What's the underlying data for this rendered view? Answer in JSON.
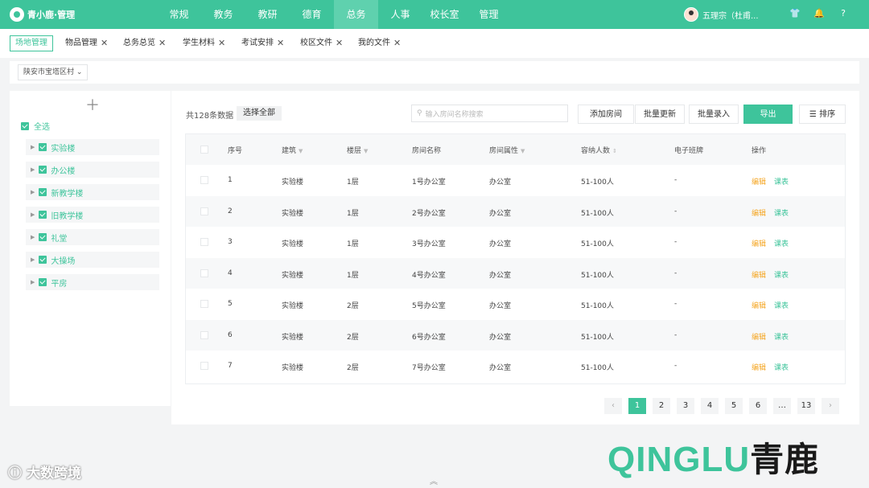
{
  "app": {
    "logo_text": "青小鹿·管理"
  },
  "nav": [
    {
      "label": "常规"
    },
    {
      "label": "教务"
    },
    {
      "label": "教研"
    },
    {
      "label": "德育"
    },
    {
      "label": "总务"
    },
    {
      "label": "人事"
    },
    {
      "label": "校长室"
    },
    {
      "label": "管理"
    }
  ],
  "nav_active": "总务",
  "user": {
    "name": "五理宗（杜甫..."
  },
  "tabs": [
    {
      "label": "场地管理",
      "closable": false,
      "active": true
    },
    {
      "label": "物品管理",
      "closable": true
    },
    {
      "label": "总务总览",
      "closable": true
    },
    {
      "label": "学生材料",
      "closable": true
    },
    {
      "label": "考试安排",
      "closable": true
    },
    {
      "label": "校区文件",
      "closable": true
    },
    {
      "label": "我的文件",
      "closable": true
    }
  ],
  "filter": {
    "region": "陕安市宝塔区村"
  },
  "tree": {
    "all_label": "全选",
    "items": [
      {
        "label": "实验楼"
      },
      {
        "label": "办公楼"
      },
      {
        "label": "新教学楼"
      },
      {
        "label": "旧教学楼"
      },
      {
        "label": "礼堂"
      },
      {
        "label": "大操场"
      },
      {
        "label": "平房"
      }
    ]
  },
  "toolbar": {
    "count_text": "共128条数据",
    "select_all": "选择全部",
    "search_placeholder": "输入房间名称搜索",
    "add_room": "添加房间",
    "batch_update": "批量更新",
    "batch_entry": "批量录入",
    "export": "导出",
    "sort": "排序"
  },
  "table": {
    "headers": {
      "index": "序号",
      "building": "建筑",
      "floor": "楼层",
      "room_name": "房间名称",
      "room_attr": "房间属性",
      "capacity": "容纳人数",
      "eboard": "电子班牌",
      "ops": "操作"
    },
    "rows": [
      {
        "index": "1",
        "building": "实验楼",
        "floor": "1层",
        "room": "1号办公室",
        "attr": "办公室",
        "capacity": "51-100人",
        "eboard": "-",
        "edit": "编辑",
        "sched": "课表"
      },
      {
        "index": "2",
        "building": "实验楼",
        "floor": "1层",
        "room": "2号办公室",
        "attr": "办公室",
        "capacity": "51-100人",
        "eboard": "-",
        "edit": "编辑",
        "sched": "课表"
      },
      {
        "index": "3",
        "building": "实验楼",
        "floor": "1层",
        "room": "3号办公室",
        "attr": "办公室",
        "capacity": "51-100人",
        "eboard": "-",
        "edit": "编辑",
        "sched": "课表"
      },
      {
        "index": "4",
        "building": "实验楼",
        "floor": "1层",
        "room": "4号办公室",
        "attr": "办公室",
        "capacity": "51-100人",
        "eboard": "-",
        "edit": "编辑",
        "sched": "课表"
      },
      {
        "index": "5",
        "building": "实验楼",
        "floor": "2层",
        "room": "5号办公室",
        "attr": "办公室",
        "capacity": "51-100人",
        "eboard": "-",
        "edit": "编辑",
        "sched": "课表"
      },
      {
        "index": "6",
        "building": "实验楼",
        "floor": "2层",
        "room": "6号办公室",
        "attr": "办公室",
        "capacity": "51-100人",
        "eboard": "-",
        "edit": "编辑",
        "sched": "课表"
      },
      {
        "index": "7",
        "building": "实验楼",
        "floor": "2层",
        "room": "7号办公室",
        "attr": "办公室",
        "capacity": "51-100人",
        "eboard": "-",
        "edit": "编辑",
        "sched": "课表"
      }
    ]
  },
  "pagination": {
    "pages": [
      "1",
      "2",
      "3",
      "4",
      "5",
      "6",
      "…",
      "13"
    ],
    "active": "1",
    "prev": "‹",
    "next": "›"
  },
  "brand": {
    "latin": "QINGLU",
    "cn": "青鹿"
  },
  "watermark": {
    "text": "大数跨境"
  },
  "colors": {
    "accent": "#3ec49b",
    "edit": "#f5a623"
  }
}
